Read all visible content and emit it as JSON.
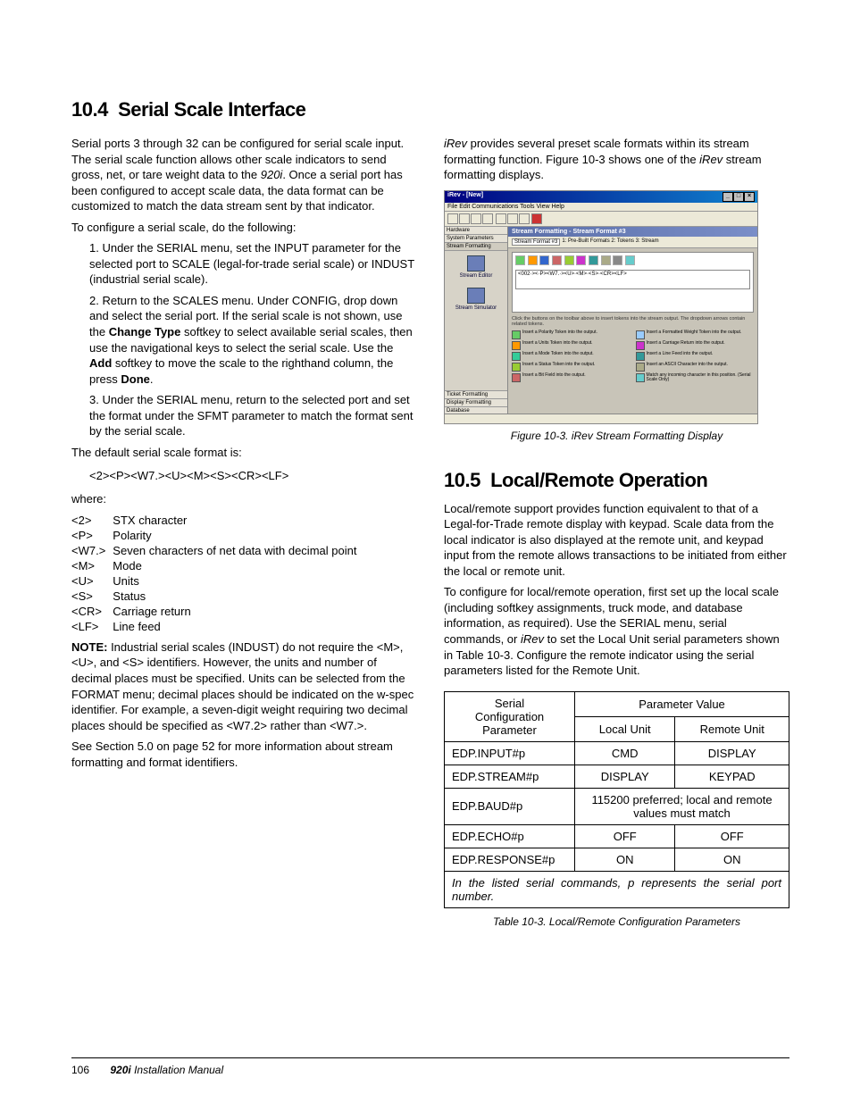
{
  "sections": {
    "s104": {
      "num": "10.4",
      "title": "Serial Scale Interface"
    },
    "s105": {
      "num": "10.5",
      "title": "Local/Remote Operation"
    }
  },
  "left": {
    "p1_a": "Serial ports 3 through 32 can be configured for serial scale input. The serial scale function allows other scale indicators to send gross, net, or tare weight data to the ",
    "p1_i": "920i",
    "p1_b": ". Once a serial port has been configured to accept scale data, the data format can be customized to match the data stream sent by that indicator.",
    "p2": "To configure a serial scale, do the following:",
    "steps": {
      "s1": "1. Under the SERIAL menu, set the INPUT parameter for the selected port to SCALE (legal-for-trade serial scale) or INDUST (industrial serial scale).",
      "s2": "2. Return to the SCALES menu. Under CONFIG, drop down and select the serial port. If the serial scale is not shown, use the ",
      "s2b": "Change Type",
      "s2c": " softkey to select available serial scales, then use the navigational keys to select the serial scale. Use the ",
      "s2d": "Add",
      "s2e": " softkey to move the scale to the righthand column, the press ",
      "s2f": "Done",
      "s2g": ".",
      "s3": "3. Under the SERIAL menu, return to the selected port and set the format under the SFMT parameter to match the format sent by the serial scale."
    },
    "default_fmt_label": "The default serial scale format is:",
    "default_fmt": "<2><P><W7.><U><M><S><CR><LF>",
    "where": "where:",
    "tokens": [
      {
        "k": "<2>",
        "v": "STX character"
      },
      {
        "k": "<P>",
        "v": "Polarity"
      },
      {
        "k": "<W7.>",
        "v": "Seven characters of net data with decimal point"
      },
      {
        "k": "<M>",
        "v": "Mode"
      },
      {
        "k": "<U>",
        "v": "Units"
      },
      {
        "k": "<S>",
        "v": "Status"
      },
      {
        "k": "<CR>",
        "v": "Carriage return"
      },
      {
        "k": "<LF>",
        "v": "Line feed"
      }
    ],
    "note_label": "NOTE:",
    "note_text": " Industrial serial scales (INDUST) do not require the <M>, <U>, and <S> identifiers. However, the units and number of decimal places must be specified. Units can be selected from the FORMAT menu; decimal places should be indicated on the w-spec identifier. For example, a seven-digit weight requiring two decimal places should be specified as <W7.2> rather than <W7.>.",
    "closing": "See Section 5.0 on page 52 for more information about stream formatting and format identifiers."
  },
  "right": {
    "irev_intro": "iRev",
    "irev_intro_txt": " provides several preset scale formats within its stream formatting function. Figure 10-3 shows one of the ",
    "irev2": "iRev",
    "irev_intro_txt2": " stream formatting displays.",
    "fig_num": "Figure 10-3. ",
    "fig_txt": "iRev",
    "fig_txt2": " Stream Formatting Display",
    "ss": {
      "title": "iRev - [New]",
      "menu": "File  Edit  Communications  Tools  View  Help",
      "side": {
        "hardware": "Hardware",
        "sysparams": "System Parameters",
        "streamfmt": "Stream Formatting",
        "editor": "Stream Editor",
        "simulator": "Stream Simulator",
        "ticket": "Ticket Formatting",
        "display": "Display Formatting",
        "database": "Database"
      },
      "panel_header": "Stream Formatting - Stream Format #3",
      "sub_dd": "Stream Format #3",
      "tabs": "1: Pre-Built Formats   2: Tokens   3: Stream",
      "format_str": "<002·><·P><W7.·><U>·<M>·<S>·<CR><LF>",
      "hint": "Click the buttons on the toolbar above to insert tokens into the stream output. The dropdown arrows contain related tokens.",
      "legend_left": [
        "Insert a Polarity Token into the output.",
        "Insert a Units Token into the output.",
        "Insert a Mode Token into the output.",
        "Insert a Status Token into the output.",
        "Insert a Bit Field into the output."
      ],
      "legend_right": [
        "Insert a Formatted Weight Token into the output.",
        "Insert a Carriage Return into the output.",
        "Insert a Line Feed into the output.",
        "Insert an ASCII Character into the output.",
        "Match any incoming character in this position. (Serial Scale Only)"
      ]
    },
    "lr_p1a": "Local/remote support provides function equivalent to that of a Legal-for-Trade remote display with keypad. Scale data from the local indicator is also displayed at the remote unit, and keypad input from the remote allows transactions to be initiated from either the local or remote unit.",
    "lr_p2": "To configure for local/remote operation, first set up the local scale (including softkey assignments, truck mode, and database information, as required). Use the SERIAL menu, serial commands, or ",
    "lr_irev": "iRev",
    "lr_p2b": " to set the Local Unit serial parameters shown in Table 10-3. Configure the remote indicator using the serial parameters listed for the Remote Unit.",
    "table": {
      "h_serial": "Serial\nConfiguration Parameter",
      "h_pv": "Parameter Value",
      "h_local": "Local Unit",
      "h_remote": "Remote Unit",
      "rows": [
        {
          "p": "EDP.INPUT#p",
          "l": "CMD",
          "r": "DISPLAY"
        },
        {
          "p": "EDP.STREAM#p",
          "l": "DISPLAY",
          "r": "KEYPAD"
        },
        {
          "p": "EDP.BAUD#p",
          "span": "115200 preferred; local and remote values must match"
        },
        {
          "p": "EDP.ECHO#p",
          "l": "OFF",
          "r": "OFF"
        },
        {
          "p": "EDP.RESPONSE#p",
          "l": "ON",
          "r": "ON"
        }
      ],
      "footnote": "In the listed serial commands, p represents the serial port number."
    },
    "tbl_caption": "Table 10-3. Local/Remote Configuration Parameters"
  },
  "footer": {
    "page": "106",
    "title1": "920i",
    "title2": " Installation Manual"
  }
}
